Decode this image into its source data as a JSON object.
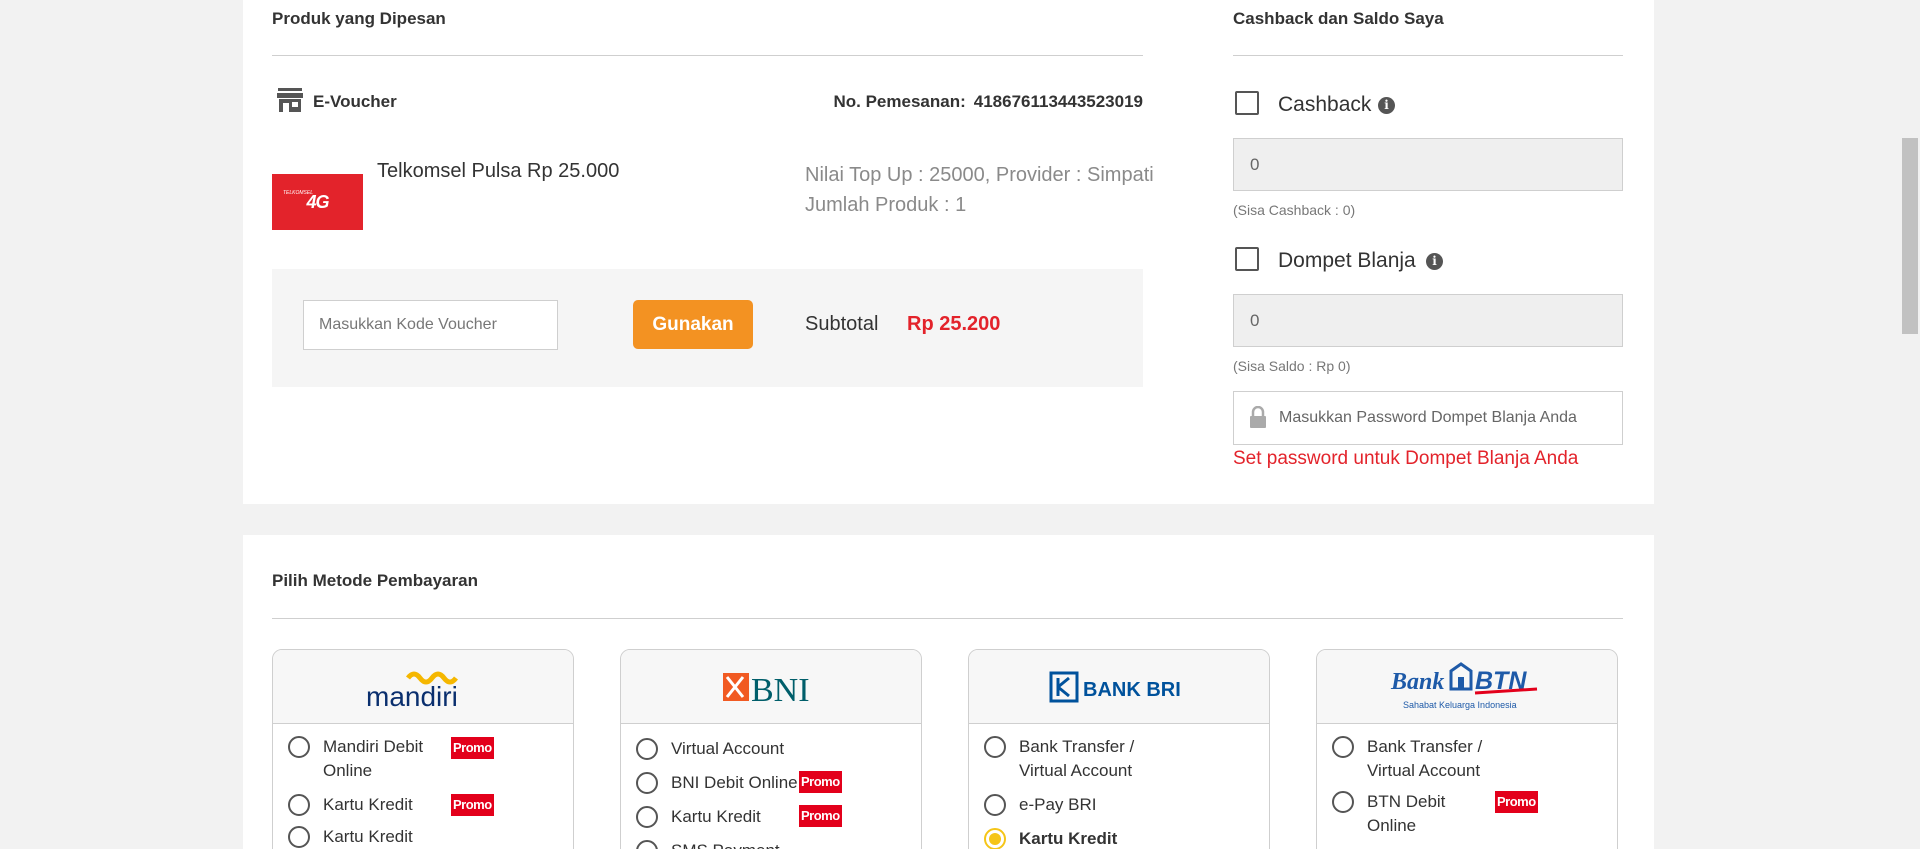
{
  "order_section": {
    "title": "Produk yang Dipesan",
    "store_type": "E-Voucher",
    "order_no_label": "No. Pemesanan:",
    "order_no": "418676113443523019",
    "product": {
      "image_brand": "4G",
      "image_small": "TELKOMSEL",
      "name": "Telkomsel Pulsa Rp 25.000",
      "meta_line1": "Nilai Top Up : 25000,  Provider : Simpati",
      "meta_line2": "Jumlah Produk : 1"
    },
    "voucher": {
      "placeholder": "Masukkan Kode Voucher",
      "button_label": "Gunakan"
    },
    "subtotal_label": "Subtotal",
    "subtotal_value": "Rp 25.200"
  },
  "balance_section": {
    "title": "Cashback dan Saldo Saya",
    "cashback": {
      "label": "Cashback",
      "value": "0",
      "hint": "(Sisa Cashback : 0)"
    },
    "wallet": {
      "label": "Dompet Blanja",
      "value": "0",
      "hint": "(Sisa Saldo : Rp 0)",
      "password_placeholder": "Masukkan Password Dompet Blanja Anda",
      "set_password_link": "Set password untuk Dompet Blanja Anda"
    }
  },
  "payment_section": {
    "title": "Pilih Metode Pembayaran",
    "promo_label": "Promo",
    "banks": [
      {
        "name": "mandiri",
        "options": [
          {
            "line1": "Mandiri Debit",
            "line2": "Online"
          },
          {
            "line1": "Kartu Kredit"
          },
          {
            "line1": "Kartu Kredit"
          }
        ]
      },
      {
        "name": "BNI",
        "options": [
          {
            "line1": "Virtual Account"
          },
          {
            "line1": "BNI Debit Online"
          },
          {
            "line1": "Kartu Kredit"
          },
          {
            "line1": "SMS Payment"
          }
        ]
      },
      {
        "name": "BANK BRI",
        "options": [
          {
            "line1": "Bank Transfer /",
            "line2": "Virtual Account"
          },
          {
            "line1": "e-Pay BRI"
          },
          {
            "line1": "Kartu Kredit"
          }
        ]
      },
      {
        "name_part1": "Bank",
        "name_part2": "BTN",
        "tagline": "Sahabat Keluarga Indonesia",
        "options": [
          {
            "line1": "Bank Transfer /",
            "line2": "Virtual Account"
          },
          {
            "line1": "BTN Debit",
            "line2": "Online"
          }
        ]
      }
    ]
  },
  "colors": {
    "accent_red": "#e3232b",
    "button_orange": "#f39222",
    "promo_red": "#e3001b",
    "mandiri_blue": "#0a2f6e",
    "mandiri_gold": "#f5b700",
    "bni_orange": "#f15a22",
    "bni_teal": "#005e6a",
    "bri_blue": "#00529c",
    "btn_blue": "#1e5aa8",
    "radio_selected": "#f5c518"
  },
  "icons": [
    "store-icon",
    "info-icon",
    "lock-icon"
  ]
}
